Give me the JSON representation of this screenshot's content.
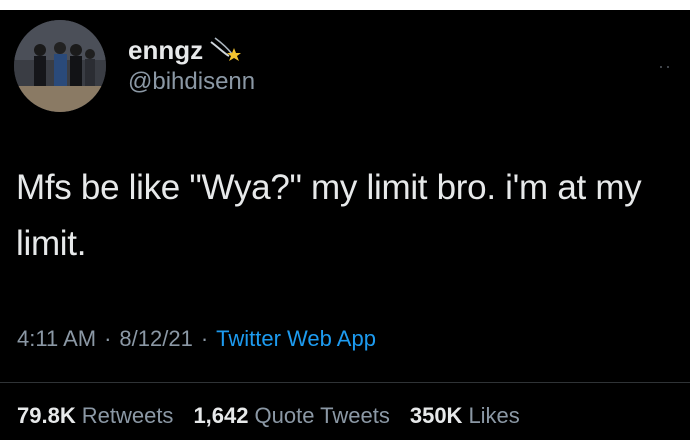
{
  "user": {
    "display_name": "enngz",
    "display_name_emoji": "comet-icon",
    "handle": "@bihdisenn",
    "avatar": "avatar-photo"
  },
  "tweet": {
    "text": "Mfs be like \"Wya?\" my limit bro.  i'm at my limit."
  },
  "meta": {
    "time": "4:11 AM",
    "separator": "·",
    "date": "8/12/21",
    "source": "Twitter Web App"
  },
  "stats": [
    {
      "value": "79.8K",
      "label": "Retweets"
    },
    {
      "value": "1,642",
      "label": "Quote Tweets"
    },
    {
      "value": "350K",
      "label": "Likes"
    }
  ],
  "colors": {
    "background": "#000000",
    "text": "#e7e9ea",
    "secondary": "#8b98a5",
    "link": "#1d9bf0"
  }
}
